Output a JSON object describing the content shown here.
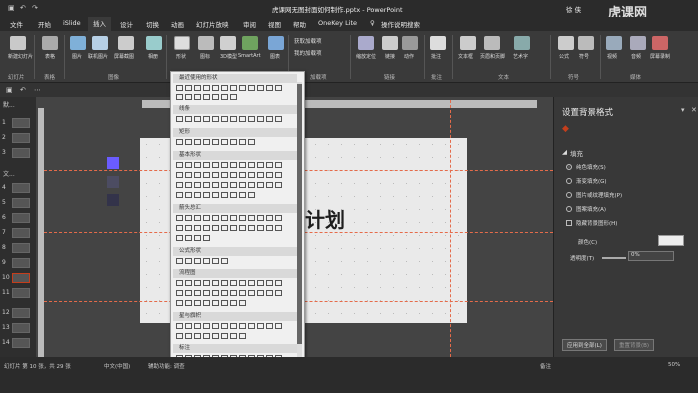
{
  "titlebar": {
    "filename": "虎课网无图封面如何制作.pptx",
    "separator": "-",
    "app": "PowerPoint",
    "user": "徐 侠",
    "watermark": "虎课网"
  },
  "tabs": [
    "文件",
    "开始",
    "iSlide",
    "插入",
    "设计",
    "切换",
    "动画",
    "幻灯片放映",
    "审阅",
    "视图",
    "帮助",
    "OneKey Lite",
    "操作说明搜索"
  ],
  "ribbon": {
    "buttons": [
      {
        "label": "新建幻灯片"
      },
      {
        "label": "表格"
      },
      {
        "label": "图片"
      },
      {
        "label": "联机图片"
      },
      {
        "label": "屏幕截图"
      },
      {
        "label": "相册"
      },
      {
        "label": "形状"
      },
      {
        "label": "图标"
      },
      {
        "label": "3D模型"
      },
      {
        "label": "SmartArt"
      },
      {
        "label": "图表"
      },
      {
        "label": "获取加载项"
      },
      {
        "label": "我的加载项"
      },
      {
        "label": "缩放定位"
      },
      {
        "label": "链接"
      },
      {
        "label": "动作"
      },
      {
        "label": "批注"
      },
      {
        "label": "文本框"
      },
      {
        "label": "页眉和页脚"
      },
      {
        "label": "艺术字"
      },
      {
        "label": "公式"
      },
      {
        "label": "符号"
      },
      {
        "label": "视频"
      },
      {
        "label": "音频"
      },
      {
        "label": "屏幕录制"
      }
    ],
    "groups": [
      "幻灯片",
      "表格",
      "图像",
      "加载项",
      "链接",
      "批注",
      "文本",
      "符号",
      "媒体"
    ]
  },
  "thumbs": [
    "1",
    "2",
    "3",
    "4",
    "5",
    "6",
    "7",
    "8",
    "9",
    "10",
    "11",
    "12",
    "13",
    "14"
  ],
  "thumb_sections": {
    "top": "默...",
    "mid": "文..."
  },
  "shapes_panel": {
    "categories": [
      "最近使用的形状",
      "线条",
      "矩形",
      "基本形状",
      "箭头总汇",
      "公式形状",
      "流程图",
      "星与旗帜",
      "标注"
    ]
  },
  "slide": {
    "text": "计划"
  },
  "right_pane": {
    "title": "设置背景格式",
    "section": "填充",
    "options": [
      "纯色填充(S)",
      "渐变填充(G)",
      "图片或纹理填充(P)",
      "图案填充(A)",
      "隐藏背景图形(H)"
    ],
    "color_label": "颜色(C)",
    "transparency_label": "透明度(T)",
    "transparency_value": "0%",
    "apply_all": "应用到全部(L)",
    "reset": "重置背景(B)"
  },
  "status": {
    "slide_info": "幻灯片 第 10 张，共 29 张",
    "language": "中文(中国)",
    "accessibility": "辅助功能: 调查",
    "notes": "备注",
    "zoom": "50%"
  },
  "colors": {
    "accent": "#c43e1c",
    "purple": "#6a5cff",
    "dark": "#1e1e1e"
  }
}
